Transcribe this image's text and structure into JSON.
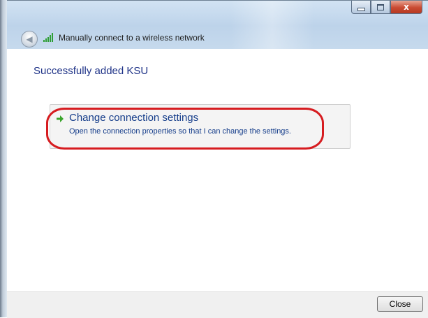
{
  "window": {
    "title": "Manually connect to a wireless network",
    "buttons": {
      "minimize": "minimize",
      "maximize": "maximize",
      "close": "x"
    }
  },
  "main": {
    "heading": "Successfully added KSU",
    "command_link": {
      "title": "Change connection settings",
      "description": "Open the connection properties so that I can change the settings."
    }
  },
  "footer": {
    "close_label": "Close"
  },
  "icons": {
    "back": "back-arrow-icon",
    "wifi": "wireless-signal-icon",
    "command": "green-arrow-icon"
  },
  "colors": {
    "heading": "#1e3287",
    "link": "#153d8a",
    "highlight": "#d61c20",
    "arrow": "#3aa52b"
  }
}
